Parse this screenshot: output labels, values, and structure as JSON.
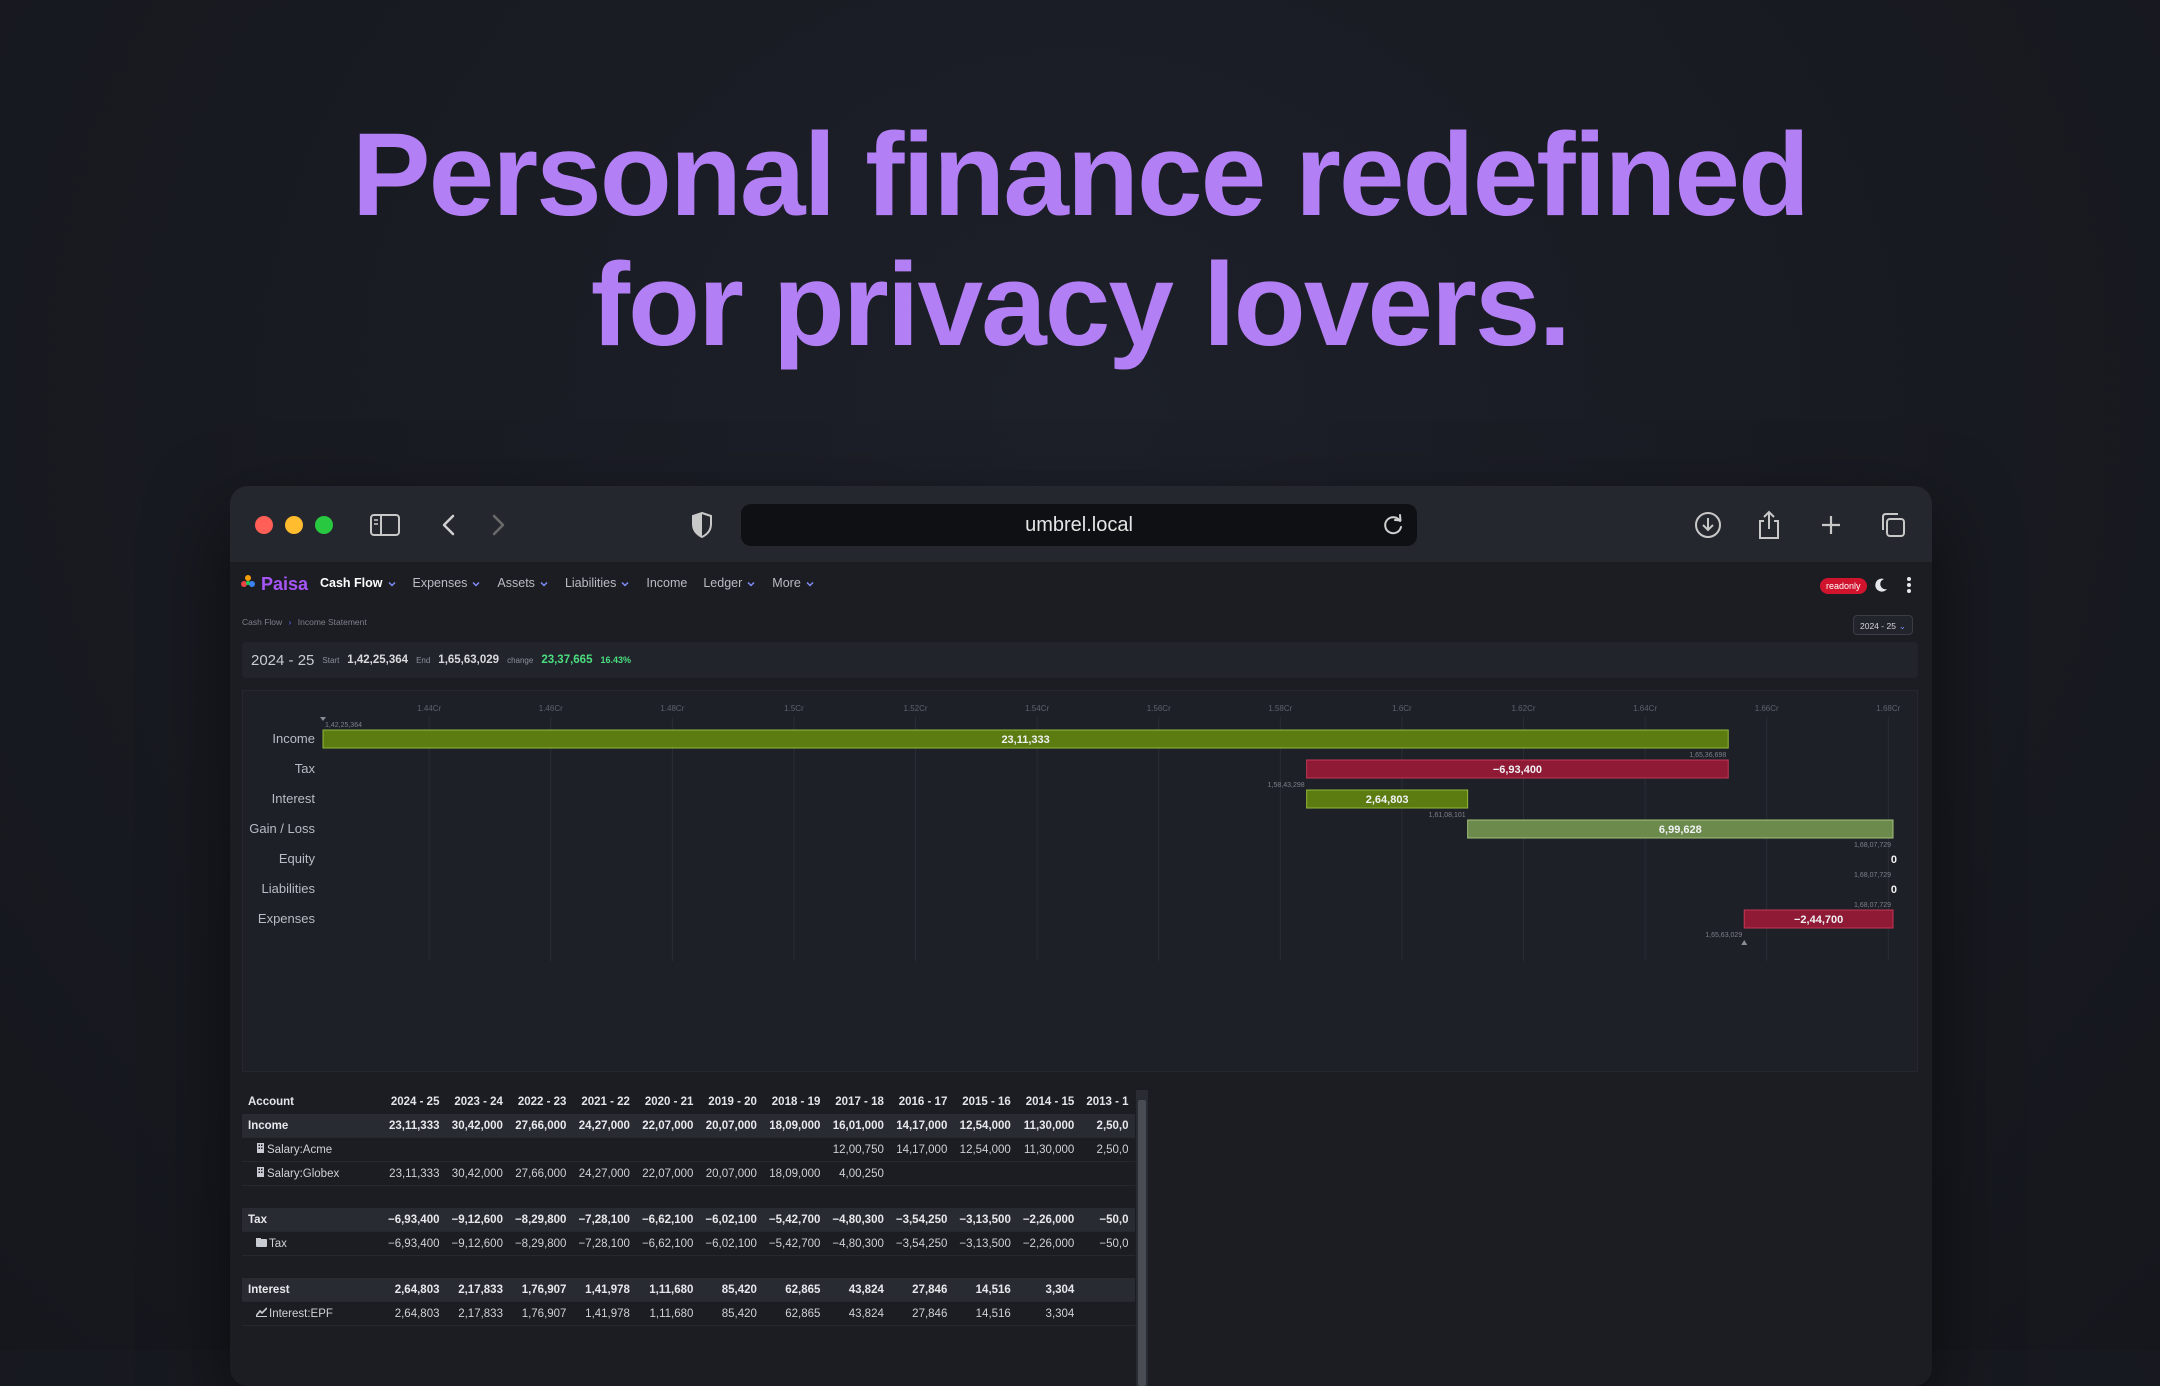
{
  "hero": {
    "line1": "Personal finance redefined",
    "line2": "for privacy lovers."
  },
  "browser": {
    "url": "umbrel.local"
  },
  "app": {
    "brand": "Paisa",
    "nav": [
      {
        "label": "Cash Flow",
        "active": true,
        "dropdown": true
      },
      {
        "label": "Expenses",
        "dropdown": true
      },
      {
        "label": "Assets",
        "dropdown": true
      },
      {
        "label": "Liabilities",
        "dropdown": true
      },
      {
        "label": "Income",
        "dropdown": false
      },
      {
        "label": "Ledger",
        "dropdown": true
      },
      {
        "label": "More",
        "dropdown": true
      }
    ],
    "badge": "readonly",
    "breadcrumb": {
      "root": "Cash Flow",
      "current": "Income Statement"
    },
    "year_select": "2024 - 25",
    "summary": {
      "year": "2024 - 25",
      "start_label": "Start",
      "start": "1,42,25,364",
      "end_label": "End",
      "end": "1,65,63,029",
      "change_label": "change",
      "change": "23,37,665",
      "change_pct": "16.43%"
    }
  },
  "colors": {
    "accent": "#b37ff5",
    "income": "#5c7c12",
    "expense": "#8e1a35",
    "gain": "#6b8a4c",
    "badge": "#d0142e",
    "positive": "#4ade80"
  },
  "chart_data": {
    "type": "bar",
    "subtype": "waterfall",
    "x_ticks": [
      "1.44Cr",
      "1.46Cr",
      "1.48Cr",
      "1.5Cr",
      "1.52Cr",
      "1.54Cr",
      "1.56Cr",
      "1.58Cr",
      "1.6Cr",
      "1.62Cr",
      "1.64Cr",
      "1.66Cr",
      "1.68Cr"
    ],
    "xlim": [
      14225364,
      16807729
    ],
    "categories": [
      "Income",
      "Tax",
      "Interest",
      "Gain / Loss",
      "Equity",
      "Liabilities",
      "Expenses"
    ],
    "bars": [
      {
        "category": "Income",
        "start": 14225364,
        "end": 16536697,
        "value_label": "23,11,333",
        "start_label": "1,42,25,364",
        "end_label": "1,65,36,698",
        "kind": "income"
      },
      {
        "category": "Tax",
        "start": 15843298,
        "end": 16536697,
        "value_label": "−6,93,400",
        "start_label": "1,58,43,298",
        "end_label": "",
        "kind": "expense"
      },
      {
        "category": "Interest",
        "start": 15843298,
        "end": 16108101,
        "value_label": "2,64,803",
        "start_label": "",
        "end_label": "1,61,08,101",
        "kind": "income"
      },
      {
        "category": "Gain / Loss",
        "start": 16108101,
        "end": 16807729,
        "value_label": "6,99,628",
        "start_label": "",
        "end_label": "1,68,07,729",
        "kind": "gain"
      },
      {
        "category": "Equity",
        "start": 16807729,
        "end": 16807729,
        "value_label": "0",
        "start_label": "",
        "end_label": "1,68,07,729",
        "kind": "zero"
      },
      {
        "category": "Liabilities",
        "start": 16807729,
        "end": 16807729,
        "value_label": "0",
        "start_label": "",
        "end_label": "1,68,07,729",
        "kind": "zero"
      },
      {
        "category": "Expenses",
        "start": 16563029,
        "end": 16807729,
        "value_label": "−2,44,700",
        "start_label": "1,65,63,029",
        "end_label": "",
        "kind": "expense"
      }
    ]
  },
  "table": {
    "columns": [
      "Account",
      "2024 - 25",
      "2023 - 24",
      "2022 - 23",
      "2021 - 22",
      "2020 - 21",
      "2019 - 20",
      "2018 - 19",
      "2017 - 18",
      "2016 - 17",
      "2015 - 16",
      "2014 - 15",
      "2013 - 1"
    ],
    "rows": [
      {
        "type": "group",
        "cells": [
          "Income",
          "23,11,333",
          "30,42,000",
          "27,66,000",
          "24,27,000",
          "22,07,000",
          "20,07,000",
          "18,09,000",
          "16,01,000",
          "14,17,000",
          "12,54,000",
          "11,30,000",
          "2,50,0"
        ]
      },
      {
        "type": "sub",
        "icon": "bank-icon",
        "cells": [
          "Salary:Acme",
          "",
          "",
          "",
          "",
          "",
          "",
          "",
          "12,00,750",
          "14,17,000",
          "12,54,000",
          "11,30,000",
          "2,50,0"
        ]
      },
      {
        "type": "sub",
        "icon": "bank-icon",
        "cells": [
          "Salary:Globex",
          "23,11,333",
          "30,42,000",
          "27,66,000",
          "24,27,000",
          "22,07,000",
          "20,07,000",
          "18,09,000",
          "4,00,250",
          "",
          "",
          "",
          ""
        ]
      },
      {
        "type": "spacer",
        "cells": []
      },
      {
        "type": "group",
        "cells": [
          "Tax",
          "−6,93,400",
          "−9,12,600",
          "−8,29,800",
          "−7,28,100",
          "−6,62,100",
          "−6,02,100",
          "−5,42,700",
          "−4,80,300",
          "−3,54,250",
          "−3,13,500",
          "−2,26,000",
          "−50,0"
        ]
      },
      {
        "type": "sub",
        "icon": "govt-icon",
        "cells": [
          "Tax",
          "−6,93,400",
          "−9,12,600",
          "−8,29,800",
          "−7,28,100",
          "−6,62,100",
          "−6,02,100",
          "−5,42,700",
          "−4,80,300",
          "−3,54,250",
          "−3,13,500",
          "−2,26,000",
          "−50,0"
        ]
      },
      {
        "type": "spacer",
        "cells": []
      },
      {
        "type": "group",
        "cells": [
          "Interest",
          "2,64,803",
          "2,17,833",
          "1,76,907",
          "1,41,978",
          "1,11,680",
          "85,420",
          "62,865",
          "43,824",
          "27,846",
          "14,516",
          "3,304",
          ""
        ]
      },
      {
        "type": "sub",
        "icon": "growth-icon",
        "cells": [
          "Interest:EPF",
          "2,64,803",
          "2,17,833",
          "1,76,907",
          "1,41,978",
          "1,11,680",
          "85,420",
          "62,865",
          "43,824",
          "27,846",
          "14,516",
          "3,304",
          ""
        ]
      }
    ]
  }
}
